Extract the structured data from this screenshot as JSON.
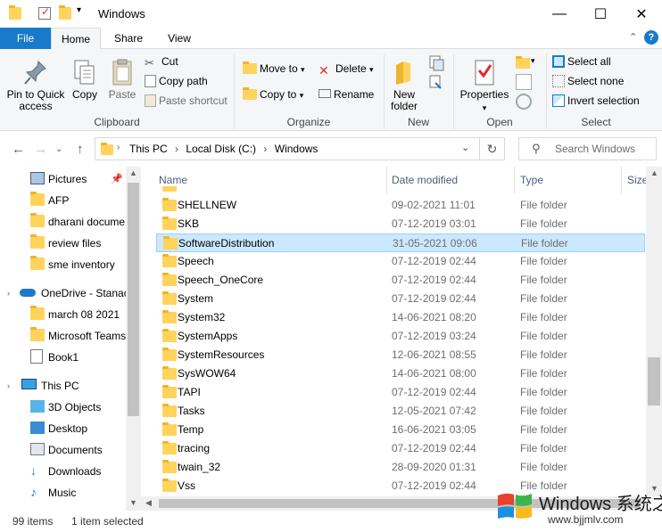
{
  "window": {
    "title": "Windows",
    "minimize": "—",
    "maximize": "☐",
    "close": "✕"
  },
  "ribbon_tabs": [
    {
      "label": "File"
    },
    {
      "label": "Home"
    },
    {
      "label": "Share"
    },
    {
      "label": "View"
    }
  ],
  "ribbon": {
    "clipboard": {
      "label": "Clipboard",
      "pin": "Pin to Quick access",
      "copy": "Copy",
      "paste": "Paste",
      "cut": "Cut",
      "copy_path": "Copy path",
      "paste_shortcut": "Paste shortcut"
    },
    "organize": {
      "label": "Organize",
      "move_to": "Move to",
      "copy_to": "Copy to",
      "delete": "Delete",
      "rename": "Rename"
    },
    "new": {
      "label": "New",
      "new_folder": "New folder"
    },
    "open": {
      "label": "Open",
      "properties": "Properties"
    },
    "select": {
      "label": "Select",
      "select_all": "Select all",
      "select_none": "Select none",
      "invert_selection": "Invert selection"
    }
  },
  "address": {
    "crumbs": [
      "This PC",
      "Local Disk (C:)",
      "Windows"
    ],
    "search_placeholder": "Search Windows"
  },
  "nav_pane": {
    "items": [
      {
        "label": "Pictures",
        "icon": "pictures-icon"
      },
      {
        "label": "AFP",
        "icon": "folder-icon"
      },
      {
        "label": "dharani docume",
        "icon": "folder-icon"
      },
      {
        "label": "review files",
        "icon": "folder-icon"
      },
      {
        "label": "sme inventory",
        "icon": "folder-icon"
      },
      {
        "label": "OneDrive - Stanac",
        "icon": "onedrive-icon"
      },
      {
        "label": "march 08 2021",
        "icon": "folder-icon"
      },
      {
        "label": "Microsoft Teams",
        "icon": "folder-icon"
      },
      {
        "label": "Book1",
        "icon": "excel-file-icon"
      },
      {
        "label": "This PC",
        "icon": "this-pc-icon"
      },
      {
        "label": "3D Objects",
        "icon": "3d-objects-icon"
      },
      {
        "label": "Desktop",
        "icon": "desktop-icon"
      },
      {
        "label": "Documents",
        "icon": "documents-icon"
      },
      {
        "label": "Downloads",
        "icon": "downloads-icon"
      },
      {
        "label": "Music",
        "icon": "music-icon"
      }
    ]
  },
  "columns": {
    "name": "Name",
    "date": "Date modified",
    "type": "Type",
    "size": "Size"
  },
  "files": [
    {
      "name": "SHELLNEW",
      "date": "09-02-2021 11:01",
      "type": "File folder"
    },
    {
      "name": "SKB",
      "date": "07-12-2019 03:01",
      "type": "File folder"
    },
    {
      "name": "SoftwareDistribution",
      "date": "31-05-2021 09:06",
      "type": "File folder",
      "selected": true
    },
    {
      "name": "Speech",
      "date": "07-12-2019 02:44",
      "type": "File folder"
    },
    {
      "name": "Speech_OneCore",
      "date": "07-12-2019 02:44",
      "type": "File folder"
    },
    {
      "name": "System",
      "date": "07-12-2019 02:44",
      "type": "File folder"
    },
    {
      "name": "System32",
      "date": "14-06-2021 08:20",
      "type": "File folder"
    },
    {
      "name": "SystemApps",
      "date": "07-12-2019 03:24",
      "type": "File folder"
    },
    {
      "name": "SystemResources",
      "date": "12-06-2021 08:55",
      "type": "File folder"
    },
    {
      "name": "SysWOW64",
      "date": "14-06-2021 08:00",
      "type": "File folder"
    },
    {
      "name": "TAPI",
      "date": "07-12-2019 02:44",
      "type": "File folder"
    },
    {
      "name": "Tasks",
      "date": "12-05-2021 07:42",
      "type": "File folder"
    },
    {
      "name": "Temp",
      "date": "16-06-2021 03:05",
      "type": "File folder"
    },
    {
      "name": "tracing",
      "date": "07-12-2019 02:44",
      "type": "File folder"
    },
    {
      "name": "twain_32",
      "date": "28-09-2020 01:31",
      "type": "File folder"
    },
    {
      "name": "Vss",
      "date": "07-12-2019 02:44",
      "type": "File folder"
    }
  ],
  "status": {
    "items": "99 items",
    "selected": "1 item selected"
  },
  "watermark": {
    "text": "Windows 系统之家",
    "url": "www.bjjmlv.com"
  },
  "colors": {
    "accent": "#1979ca",
    "selection": "#cce8ff",
    "folder": "#ffd35c"
  }
}
